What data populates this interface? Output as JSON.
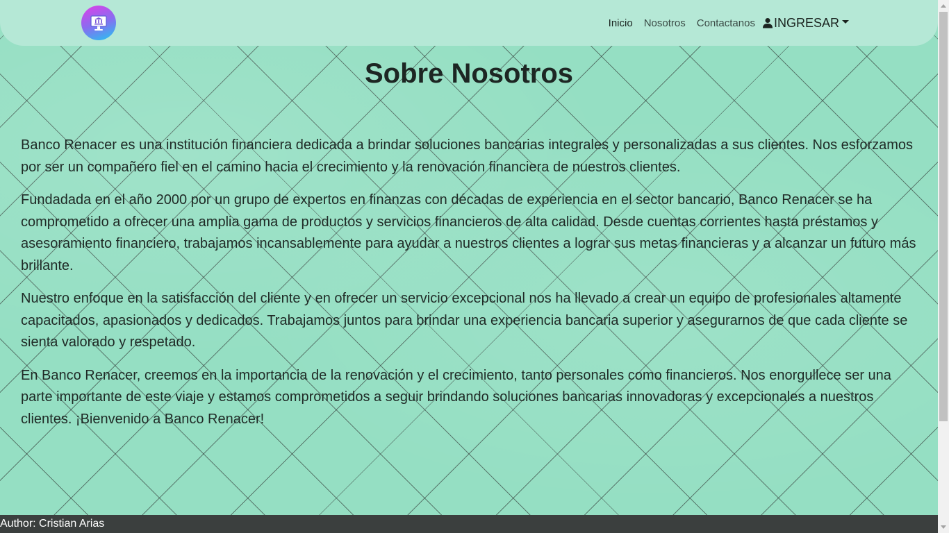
{
  "nav": {
    "links": [
      {
        "label": "Inicio"
      },
      {
        "label": "Nosotros"
      },
      {
        "label": "Contactanos"
      }
    ],
    "login_label": "INGRESAR",
    "icons": {
      "logo": "bank-computer-logo-icon",
      "user": "user-icon",
      "caret": "caret-down-icon"
    }
  },
  "main": {
    "title": "Sobre Nosotros",
    "paragraphs": [
      "Banco Renacer es una institución financiera dedicada a brindar soluciones bancarias integrales y personalizadas a sus clientes. Nos esforzamos por ser un compañero fiel en el camino hacia el crecimiento y la renovación financiera de nuestros clientes.",
      "Fundadada en el año 2000 por un grupo de expertos en finanzas con décadas de experiencia en el sector bancario, Banco Renacer se ha comprometido a ofrecer una amplia gama de productos y servicios financieros de alta calidad. Desde cuentas corrientes hasta préstamos y asesoramiento financiero, trabajamos incansablemente para ayudar a nuestros clientes a lograr sus metas financieras y a alcanzar un futuro más brillante.",
      "Nuestro enfoque en la satisfacción del cliente y en ofrecer un servicio excepcional nos ha llevado a crear un equipo de profesionales altamente capacitados, apasionados y dedicados. Trabajamos juntos para brindar una experiencia bancaria superior y asegurarnos de que cada cliente se sienta valorado y respetado.",
      "En Banco Renacer, creemos en la importancia de la renovación y el crecimiento, tanto personales como financieros. Nos enorgullece ser una parte importante de este viaje y estamos comprometidos a seguir brindando soluciones bancarias innovadoras y excepcionales a nuestros clientes. ¡Bienvenido a Banco Renacer!"
    ]
  },
  "footer": {
    "text": "Author: Cristian Arias"
  },
  "colors": {
    "background": "#95dfc3",
    "navbar": "#b5e8d6",
    "footer": "#3b3f3e"
  }
}
